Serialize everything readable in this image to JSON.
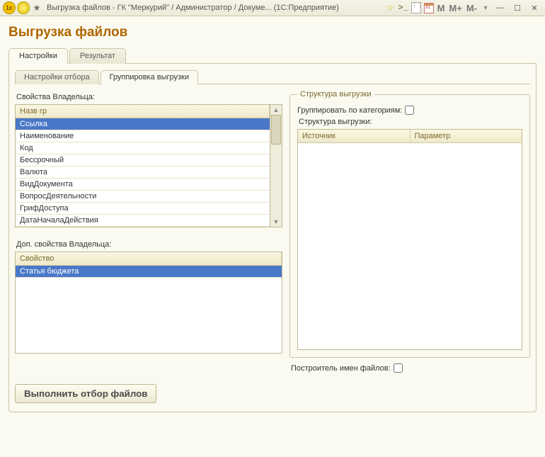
{
  "window": {
    "title": "Выгрузка файлов - ГК \"Меркурий\" / Администратор / Докуме... (1С:Предприятие)"
  },
  "page_title": "Выгрузка файлов",
  "tabs": {
    "settings": "Настройки",
    "result": "Результат"
  },
  "inner_tabs": {
    "filter": "Настройки отбора",
    "grouping": "Группировка выгрузки"
  },
  "owner_props": {
    "label": "Свойства Владельца:",
    "header": "Назв гр",
    "items": [
      "Ссылка",
      "Наименование",
      "Код",
      "Бессрочный",
      "Валюта",
      "ВидДокумента",
      "ВопросДеятельности",
      "ГрифДоступа",
      "ДатаНачалаДействия"
    ],
    "selected_index": 0
  },
  "addl_props": {
    "label": "Доп. свойства Владельца:",
    "header": "Свойство",
    "items": [
      "Статья бюджета"
    ],
    "selected_index": 0
  },
  "structure": {
    "legend": "Структура выгрузки",
    "group_by_cat": "Группировать по категориям:",
    "sub_label": "Структура выгрузки:",
    "cols": {
      "source": "Источник",
      "param": "Параметр"
    }
  },
  "filename_builder": "Построитель имен файлов:",
  "run_button": "Выполнить отбор файлов",
  "toolbar_m": {
    "m": "M",
    "mp": "M+",
    "mm": "M-"
  }
}
